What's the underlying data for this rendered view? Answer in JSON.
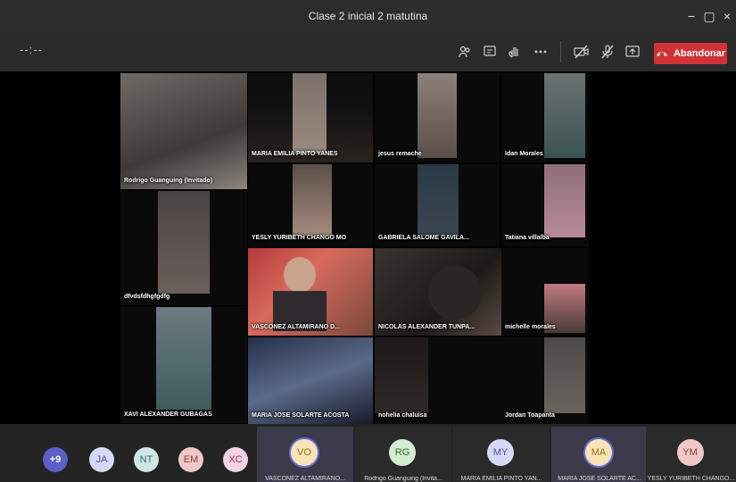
{
  "window": {
    "title": "Clase 2 inicial 2 matutina",
    "minimize": "−",
    "restore": "▢",
    "close": "×"
  },
  "toolbar": {
    "timer": "--:--",
    "leave_label": "Abandonar",
    "icons": [
      "participants-icon",
      "chat-icon",
      "raise-hand-icon",
      "more-options-icon",
      "camera-off-icon",
      "mic-off-icon",
      "share-screen-icon"
    ]
  },
  "video_tiles": [
    {
      "name": "Rodrigo Guanguing (Invitado)"
    },
    {
      "name": "MARIA EMILIA PINTO YANES"
    },
    {
      "name": "jesus remache"
    },
    {
      "name": "Idan Morales"
    },
    {
      "name": "YESLY YURIBETH CHANGO MO"
    },
    {
      "name": "GABRIELA SALOME GAVILA..."
    },
    {
      "name": "Tatiana villalba"
    },
    {
      "name": "dfvdsfdhgfgdfg"
    },
    {
      "name": "VASCONEZ ALTAMIRANO D..."
    },
    {
      "name": "NICOLAS ALEXANDER TUNPA..."
    },
    {
      "name": "michelle morales"
    },
    {
      "name": "XAVI ALEXANDER GUBAGAS"
    },
    {
      "name": "MARIA JOSE SOLARTE ACOSTA"
    },
    {
      "name": "nohelia chaluisa"
    },
    {
      "name": "Jordan Toapanta"
    }
  ],
  "bottom_strip": {
    "overflow": "+9",
    "avatars": [
      {
        "initials": "JA"
      },
      {
        "initials": "NT"
      },
      {
        "initials": "EM"
      },
      {
        "initials": "XC"
      }
    ],
    "cards": [
      {
        "initials": "VO",
        "name": "VASCONEZ ALTAMIRANO..."
      },
      {
        "initials": "RG",
        "name": "Rodrigo Guanguing (Invita..."
      },
      {
        "initials": "MY",
        "name": "MARIA EMILIA PINTO YAN..."
      },
      {
        "initials": "MA",
        "name": "MARIA JOSE SOLARTE AC..."
      },
      {
        "initials": "YM",
        "name": "YESLY YURIBETH CHANGO..."
      }
    ]
  },
  "colors": {
    "leave_button": "#d13438",
    "titlebar": "#2d2d2d",
    "toolbar": "#2b2b2b",
    "strip": "#242424"
  }
}
